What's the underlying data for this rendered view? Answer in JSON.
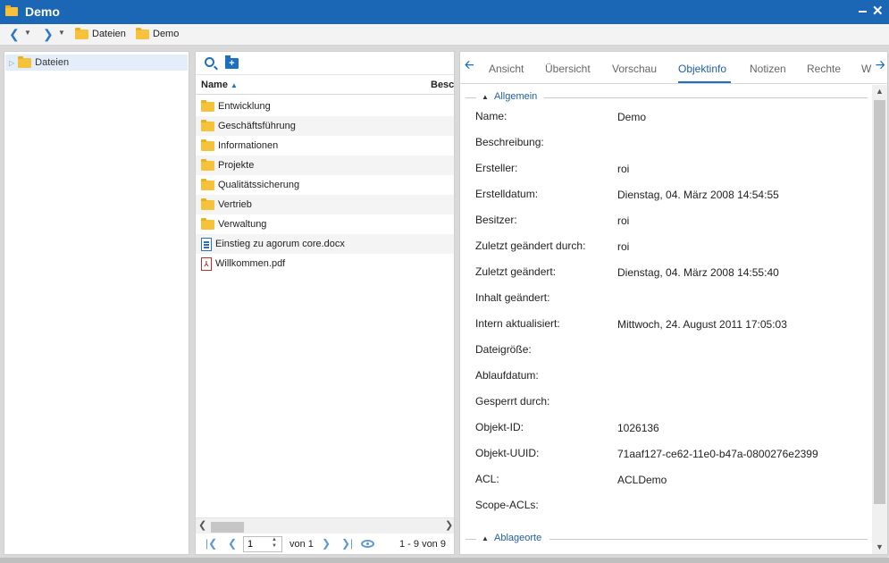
{
  "window": {
    "title": "Demo"
  },
  "nav": {
    "breadcrumbs": [
      "Dateien",
      "Demo"
    ]
  },
  "tree": {
    "items": [
      {
        "label": "Dateien"
      }
    ]
  },
  "files": {
    "columns": [
      "Name",
      "Besch"
    ],
    "rows": [
      {
        "name": "Entwicklung",
        "type": "folder"
      },
      {
        "name": "Geschäftsführung",
        "type": "folder"
      },
      {
        "name": "Informationen",
        "type": "folder"
      },
      {
        "name": "Projekte",
        "type": "folder"
      },
      {
        "name": "Qualitätssicherung",
        "type": "folder"
      },
      {
        "name": "Vertrieb",
        "type": "folder"
      },
      {
        "name": "Verwaltung",
        "type": "folder"
      },
      {
        "name": "Einstieg zu agorum core.docx",
        "type": "docx"
      },
      {
        "name": "Willkommen.pdf",
        "type": "pdf"
      }
    ],
    "pager": {
      "page": "1",
      "of_label": "von 1",
      "count_label": "1 - 9 von 9"
    }
  },
  "detail": {
    "tabs": [
      "Ansicht",
      "Übersicht",
      "Vorschau",
      "Objektinfo",
      "Notizen",
      "Rechte",
      "W"
    ],
    "active_tab": "Objektinfo",
    "section_general": "Allgemein",
    "props": [
      {
        "label": "Name:",
        "value": "Demo"
      },
      {
        "label": "Beschreibung:",
        "value": ""
      },
      {
        "label": "Ersteller:",
        "value": "roi"
      },
      {
        "label": "Erstelldatum:",
        "value": "Dienstag, 04. März 2008 14:54:55"
      },
      {
        "label": "Besitzer:",
        "value": "roi"
      },
      {
        "label": "Zuletzt geändert durch:",
        "value": "roi"
      },
      {
        "label": "Zuletzt geändert:",
        "value": "Dienstag, 04. März 2008 14:55:40"
      },
      {
        "label": "Inhalt geändert:",
        "value": ""
      },
      {
        "label": "Intern aktualisiert:",
        "value": "Mittwoch, 24. August 2011 17:05:03"
      },
      {
        "label": "Dateigröße:",
        "value": ""
      },
      {
        "label": "Ablaufdatum:",
        "value": ""
      },
      {
        "label": "Gesperrt durch:",
        "value": ""
      },
      {
        "label": "Objekt-ID:",
        "value": "1026136"
      },
      {
        "label": "Objekt-UUID:",
        "value": "71aaf127-ce62-11e0-b47a-0800276e2399"
      },
      {
        "label": "ACL:",
        "value": "ACLDemo"
      },
      {
        "label": "Scope-ACLs:",
        "value": ""
      }
    ],
    "section_locations": "Ablageorte"
  }
}
